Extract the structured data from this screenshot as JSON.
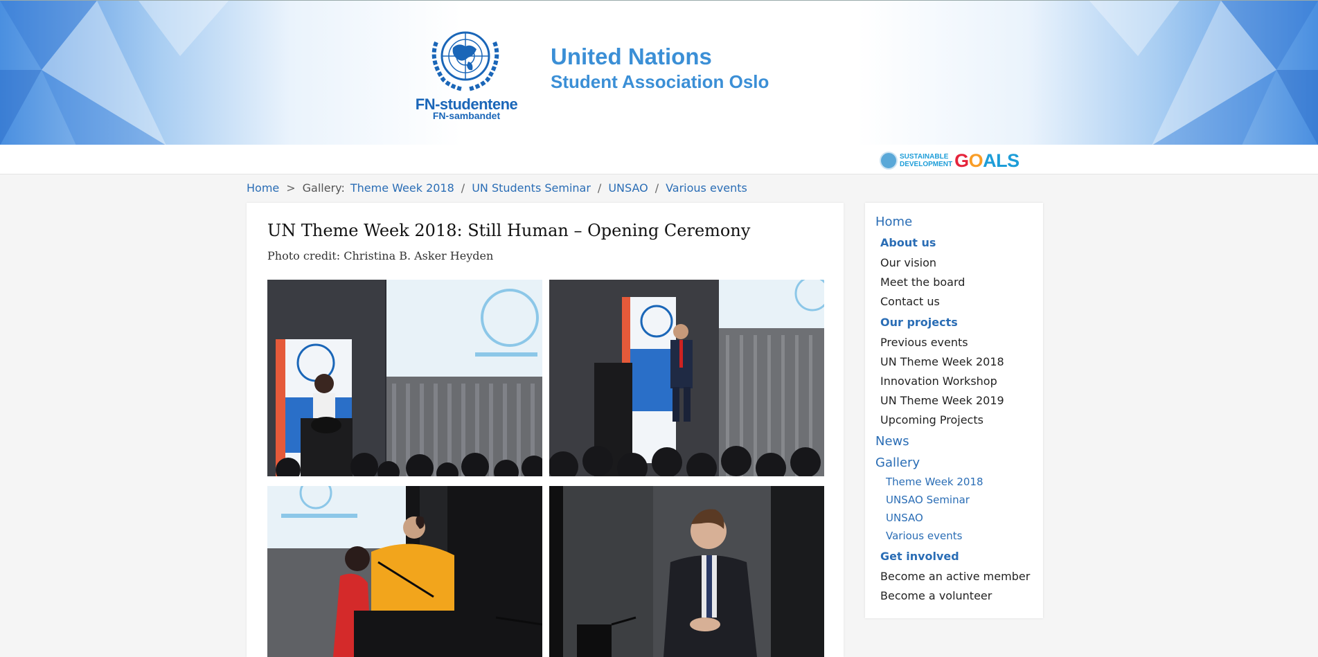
{
  "header": {
    "logo_primary": "FN-studentene",
    "logo_secondary": "FN-sambandet",
    "org_line1": "United Nations",
    "org_line2": "Student Association Oslo",
    "sdg_small_line1": "SUSTAINABLE",
    "sdg_small_line2": "DEVELOPMENT",
    "sdg_goals": "GOALS"
  },
  "breadcrumb": {
    "home": "Home",
    "separator": ">",
    "gallery_label": "Gallery:",
    "items": [
      "Theme Week 2018",
      "UN Students Seminar",
      "UNSAO",
      "Various events"
    ],
    "slash": "/"
  },
  "article": {
    "title": "UN Theme Week 2018: Still Human – Opening Ceremony",
    "credit": "Photo credit: Christina B. Asker Heyden",
    "photos": [
      {
        "description": "speaker-at-podium-woman"
      },
      {
        "description": "speaker-man-in-suit-on-stage"
      },
      {
        "description": "two-hosts-on-stage"
      },
      {
        "description": "man-in-suit-speaking"
      }
    ]
  },
  "sidebar": {
    "home": "Home",
    "about_us": "About us",
    "about_items": [
      "Our vision",
      "Meet the board",
      "Contact us"
    ],
    "our_projects": "Our projects",
    "project_items": [
      "Previous events",
      "UN Theme Week 2018",
      "Innovation Workshop",
      "UN Theme Week 2019",
      "Upcoming Projects"
    ],
    "news": "News",
    "gallery": "Gallery",
    "gallery_items": [
      "Theme Week 2018",
      "UNSAO Seminar",
      "UNSAO",
      "Various events"
    ],
    "get_involved": "Get involved",
    "involved_items": [
      "Become an active member",
      "Become a volunteer"
    ]
  },
  "colors": {
    "link_blue": "#2a6db5",
    "brand_blue": "#3b8fd6",
    "banner_edge": "#4a8fe0"
  }
}
